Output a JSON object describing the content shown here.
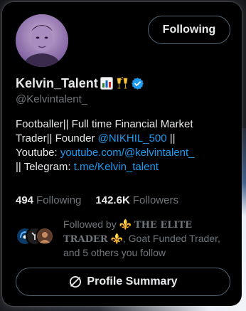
{
  "profile": {
    "display_name": "Kelvin_Talent",
    "name_emojis": [
      "bar-chart-emoji",
      "clinking-glasses-emoji"
    ],
    "verified": true,
    "handle": "@Kelvintalent_",
    "avatar_icon": "profile-photo"
  },
  "actions": {
    "following_label": "Following",
    "summary_label": "Profile Summary",
    "summary_icon": "no-entry-sign-icon"
  },
  "bio": {
    "line1_pre": "Footballer|| Full time Financial Market Trader|| Founder ",
    "mention": "@NIKHIL_500",
    "line1_post": " ||",
    "youtube_label": "Youtube: ",
    "youtube_link": "youtube.com/@kelvintalent_",
    "telegram_pre": "|| Telegram: ",
    "telegram_link": "t.me/Kelvin_talent"
  },
  "stats": {
    "following_count": "494",
    "following_label": "Following",
    "followers_count": "142.6K",
    "followers_label": "Followers"
  },
  "followed_by": {
    "prefix": "Followed by ",
    "fleur1": "⚜️",
    "elite_name": "THE ELITE TRADER",
    "fleur2": "⚜️",
    "rest": ", Goat Funded Trader, and 5 others you follow"
  },
  "colors": {
    "background": "#000000",
    "text_primary": "#e7e9ea",
    "text_secondary": "#71767b",
    "link": "#1d9bf0",
    "verified_badge": "#1d9bf0",
    "border": "#536471"
  }
}
